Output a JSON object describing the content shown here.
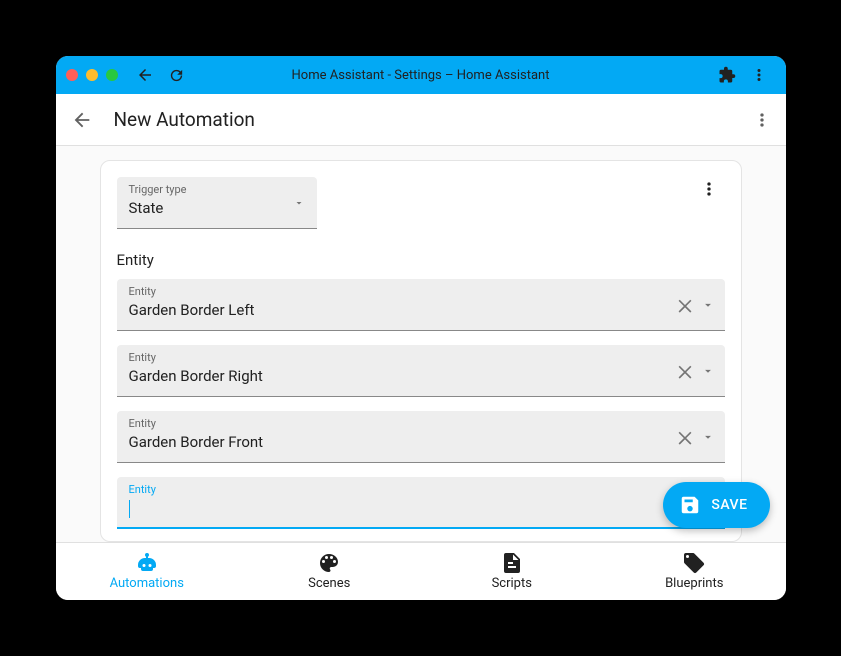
{
  "window": {
    "title": "Home Assistant - Settings – Home Assistant"
  },
  "header": {
    "title": "New Automation"
  },
  "trigger": {
    "label": "Trigger type",
    "value": "State"
  },
  "entitySection": {
    "label": "Entity",
    "fieldLabel": "Entity",
    "items": [
      {
        "value": "Garden Border Left"
      },
      {
        "value": "Garden Border Right"
      },
      {
        "value": "Garden Border Front"
      }
    ],
    "newFieldLabel": "Entity"
  },
  "fab": {
    "label": "SAVE"
  },
  "tabs": {
    "automations": "Automations",
    "scenes": "Scenes",
    "scripts": "Scripts",
    "blueprints": "Blueprints"
  }
}
